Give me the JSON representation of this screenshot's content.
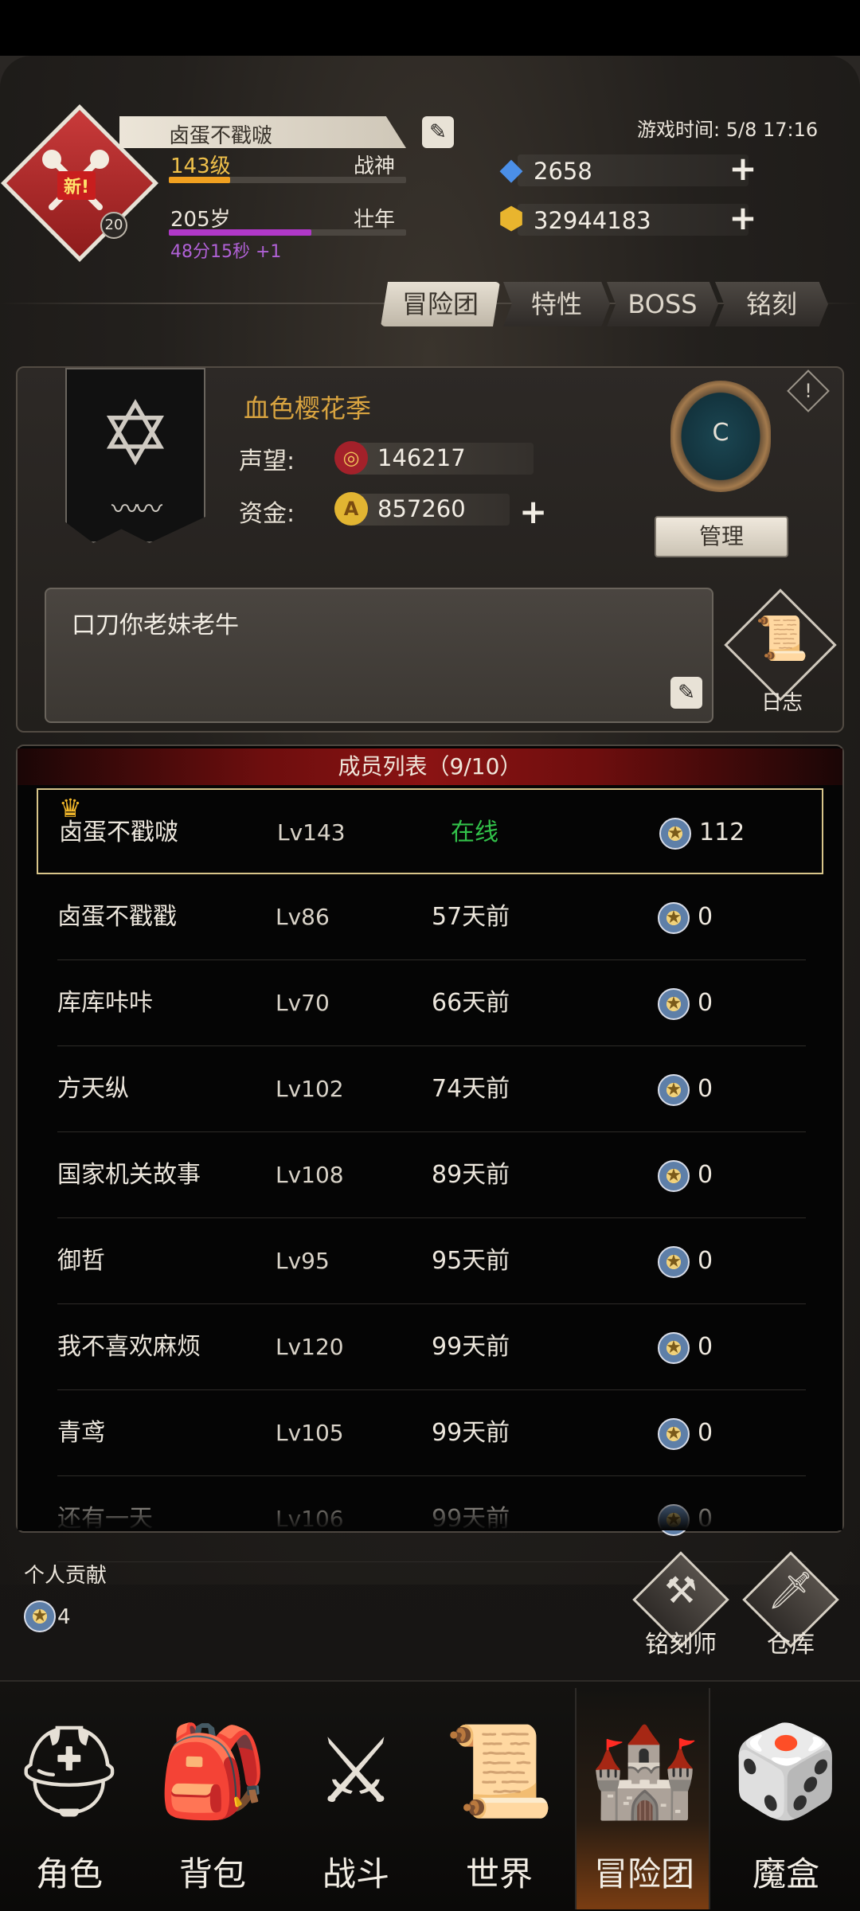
{
  "player": {
    "name": "卤蛋不戳啵",
    "level_text": "143级",
    "title": "战神",
    "level_progress": 0.26,
    "age_text": "205岁",
    "life_stage": "壮年",
    "age_progress": 0.6,
    "timer_text": "48分15秒 +1",
    "emblem_tag": "新!",
    "emblem_level": "20"
  },
  "game_time": "游戏时间: 5/8 17:16",
  "currency": {
    "gems": "2658",
    "gold": "32944183"
  },
  "tabs": [
    {
      "label": "冒险团",
      "active": true
    },
    {
      "label": "特性",
      "active": false
    },
    {
      "label": "BOSS",
      "active": false
    },
    {
      "label": "铭刻",
      "active": false
    }
  ],
  "guild": {
    "name": "血色樱花季",
    "reputation_label": "声望:",
    "reputation": "146217",
    "funds_label": "资金:",
    "funds": "857260",
    "rank": "C",
    "manage_label": "管理",
    "notice": "口刀你老妹老牛",
    "log_label": "日志"
  },
  "members": {
    "header": "成员列表（9/10）",
    "rows": [
      {
        "name": "卤蛋不戳啵",
        "level": "Lv143",
        "status": "在线",
        "contribution": "112",
        "self": true
      },
      {
        "name": "卤蛋不戳戳",
        "level": "Lv86",
        "status": "57天前",
        "contribution": "0"
      },
      {
        "name": "库库咔咔",
        "level": "Lv70",
        "status": "66天前",
        "contribution": "0"
      },
      {
        "name": "方天纵",
        "level": "Lv102",
        "status": "74天前",
        "contribution": "0"
      },
      {
        "name": "国家机关故事",
        "level": "Lv108",
        "status": "89天前",
        "contribution": "0"
      },
      {
        "name": "御哲",
        "level": "Lv95",
        "status": "95天前",
        "contribution": "0"
      },
      {
        "name": "我不喜欢麻烦",
        "level": "Lv120",
        "status": "99天前",
        "contribution": "0"
      },
      {
        "name": "青鸢",
        "level": "Lv105",
        "status": "99天前",
        "contribution": "0"
      },
      {
        "name": "还有一天",
        "level": "Lv106",
        "status": "99天前",
        "contribution": "0"
      }
    ]
  },
  "personal": {
    "label": "个人贡献",
    "value": "4"
  },
  "side_buttons": {
    "engraver": "铭刻师",
    "warehouse": "仓库"
  },
  "nav": [
    {
      "label": "角色",
      "icon": "helmet-icon"
    },
    {
      "label": "背包",
      "icon": "backpack-icon"
    },
    {
      "label": "战斗",
      "icon": "sword-shield-icon"
    },
    {
      "label": "世界",
      "icon": "scroll-map-icon"
    },
    {
      "label": "冒险团",
      "icon": "castle-icon",
      "active": true
    },
    {
      "label": "魔盒",
      "icon": "magic-box-icon"
    }
  ],
  "colors": {
    "accent_gold": "#d9a440",
    "online_green": "#32c24a",
    "level_bar": "#f0a020",
    "age_bar": "#b038c8",
    "header_red": "#8a1313"
  }
}
